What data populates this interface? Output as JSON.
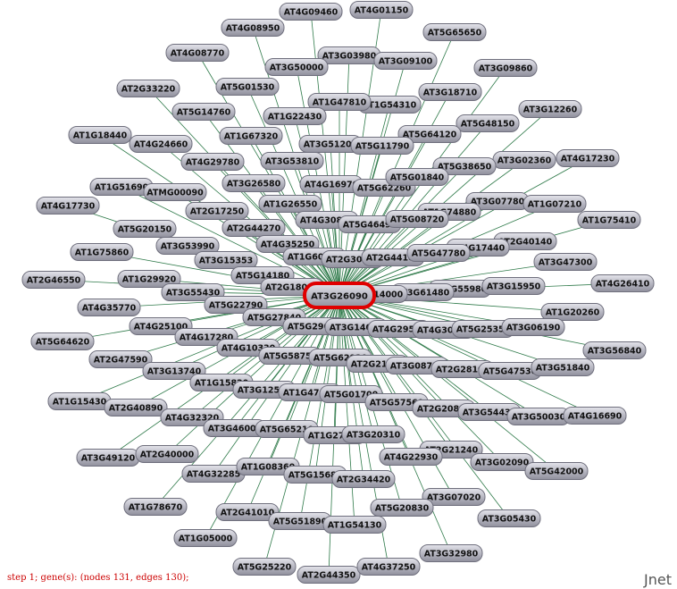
{
  "colors": {
    "edge": "#2f7a4a",
    "node_fill": "#b9b9c4",
    "node_border": "#6f6f7d",
    "hub_outline": "#e00000",
    "label": "#111111",
    "status_text": "#cc0000"
  },
  "hub": "AT3G26090",
  "status": "step 1; gene(s):  (nodes 131, edges 130);",
  "brand": "Jnet",
  "nodes": [
    "AT4G09460",
    "AT4G01150",
    "AT4G08950",
    "AT5G65650",
    "AT3G03980",
    "AT4G08770",
    "AT3G50000",
    "AT3G09100",
    "AT3G09860",
    "AT2G33220",
    "AT5G01530",
    "AT3G18710",
    "AT1G54310",
    "AT1G47810",
    "AT5G14760",
    "AT1G22430",
    "AT3G12260",
    "AT5G48150",
    "AT1G18440",
    "AT1G67320",
    "AT4G24660",
    "AT3G51200",
    "AT5G64120",
    "AT5G11790",
    "AT4G29780",
    "AT3G53810",
    "AT3G02360",
    "AT4G17230",
    "AT5G38650",
    "AT1G51690",
    "AT3G26580",
    "AT4G16970",
    "AT5G62260",
    "AT5G01840",
    "ATMG00090",
    "AT4G17730",
    "AT1G26550",
    "AT3G07780",
    "AT1G07210",
    "AT2G17250",
    "AT4G30880",
    "AT1G74880",
    "AT1G75410",
    "AT5G20150",
    "AT5G46490",
    "AT2G44270",
    "AT5G08720",
    "AT3G53990",
    "AT4G35250",
    "AT2G40140",
    "AT4G17440",
    "AT1G75860",
    "AT3G15353",
    "AT1G60800",
    "AT2G30800",
    "AT2G44100",
    "AT5G47780",
    "AT3G47300",
    "AT5G14180",
    "AT3G55980",
    "AT2G46550",
    "AT1G29920",
    "AT2G18000",
    "AT3G15950",
    "AT4G26410",
    "AT3G55430",
    "AT3G61480",
    "AT3G14000",
    "AT4G35770",
    "AT5G22790",
    "AT1G20260",
    "AT5G27840",
    "AT5G29000",
    "AT3G14000",
    "AT4G29590",
    "AT4G30000",
    "AT5G25350",
    "AT3G06190",
    "AT4G25100",
    "AT5G64620",
    "AT4G17280",
    "AT4G10330",
    "AT3G56840",
    "AT2G47590",
    "AT5G58750",
    "AT5G62920",
    "AT2G21000",
    "AT3G08730",
    "AT2G28100",
    "AT5G47530",
    "AT3G51840",
    "AT3G13740",
    "AT1G15820",
    "AT1G15430",
    "AT3G12500",
    "AT1G47400",
    "AT5G01700",
    "AT5G57560",
    "AT2G40890",
    "AT2G20800",
    "AT3G54430",
    "AT3G50030",
    "AT4G16690",
    "AT4G32320",
    "AT3G46000",
    "AT5G65210",
    "AT1G27800",
    "AT3G20310",
    "AT2G21240",
    "AT3G49120",
    "AT2G40000",
    "AT4G22930",
    "AT3G02090",
    "AT5G42000",
    "AT4G32285",
    "AT1G08360",
    "AT5G15680",
    "AT2G34420",
    "AT3G07020",
    "AT1G78670",
    "AT2G41010",
    "AT5G20830",
    "AT3G05430",
    "AT5G51890",
    "AT1G54130",
    "AT1G05000",
    "AT3G32980",
    "AT5G25220",
    "AT2G44350",
    "AT4G37250"
  ]
}
